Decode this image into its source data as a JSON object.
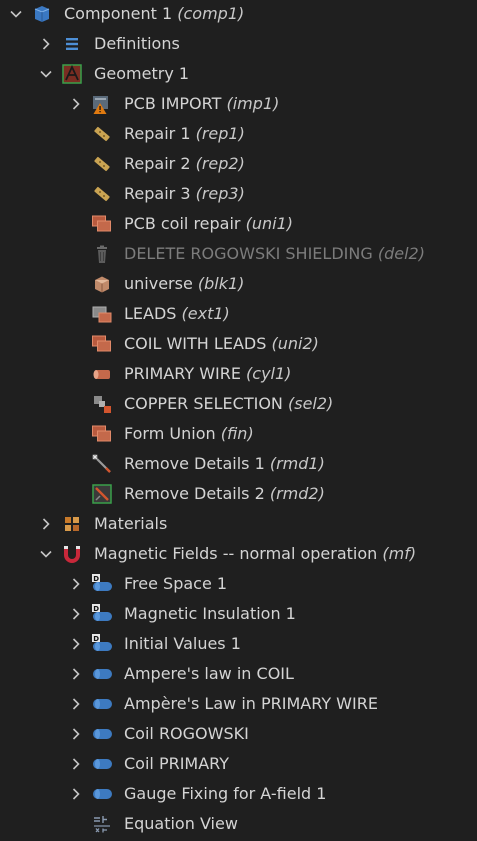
{
  "tree": {
    "component": {
      "label": "Component 1",
      "tag": "(comp1)",
      "icon": "component-cube-icon"
    },
    "definitions": {
      "label": "Definitions",
      "icon": "definitions-list-icon"
    },
    "geometry": {
      "label": "Geometry 1",
      "icon": "geometry-icon"
    },
    "geometry_items": [
      {
        "label": "PCB IMPORT",
        "tag": "(imp1)",
        "icon": "import-warning-icon"
      },
      {
        "label": "Repair 1",
        "tag": "(rep1)",
        "icon": "repair-icon"
      },
      {
        "label": "Repair 2",
        "tag": "(rep2)",
        "icon": "repair-icon"
      },
      {
        "label": "Repair 3",
        "tag": "(rep3)",
        "icon": "repair-icon"
      },
      {
        "label": "PCB coil repair",
        "tag": "(uni1)",
        "icon": "union-icon"
      },
      {
        "label": "DELETE ROGOWSKI SHIELDING",
        "tag": "(del2)",
        "icon": "trash-icon",
        "disabled": true
      },
      {
        "label": "universe",
        "tag": "(blk1)",
        "icon": "block-icon"
      },
      {
        "label": "LEADS",
        "tag": "(ext1)",
        "icon": "extrude-icon"
      },
      {
        "label": "COIL WITH LEADS",
        "tag": "(uni2)",
        "icon": "union-icon"
      },
      {
        "label": "PRIMARY WIRE",
        "tag": "(cyl1)",
        "icon": "cylinder-icon"
      },
      {
        "label": "COPPER SELECTION",
        "tag": "(sel2)",
        "icon": "selection-icon"
      },
      {
        "label": "Form Union",
        "tag": "(fin)",
        "icon": "union-icon"
      },
      {
        "label": "Remove Details 1",
        "tag": "(rmd1)",
        "icon": "magic-wand-icon"
      },
      {
        "label": "Remove Details 2",
        "tag": "(rmd2)",
        "icon": "remove-details-icon"
      }
    ],
    "materials": {
      "label": "Materials",
      "icon": "materials-icon"
    },
    "magnetic": {
      "label": "Magnetic Fields -- normal operation",
      "tag": "(mf)",
      "icon": "magnet-icon"
    },
    "physics_items": [
      {
        "label": "Free Space 1",
        "icon": "default-domain-icon"
      },
      {
        "label": "Magnetic Insulation 1",
        "icon": "default-domain-icon"
      },
      {
        "label": "Initial Values 1",
        "icon": "default-domain-icon"
      },
      {
        "label": "Ampere's law in COIL",
        "icon": "domain-icon"
      },
      {
        "label": "Ampère's Law in PRIMARY WIRE",
        "icon": "domain-icon"
      },
      {
        "label": "Coil ROGOWSKI",
        "icon": "domain-icon"
      },
      {
        "label": "Coil PRIMARY",
        "icon": "domain-icon"
      },
      {
        "label": "Gauge Fixing for A-field 1",
        "icon": "domain-icon"
      }
    ],
    "equation_view": {
      "label": "Equation View",
      "icon": "equation-view-icon"
    }
  }
}
